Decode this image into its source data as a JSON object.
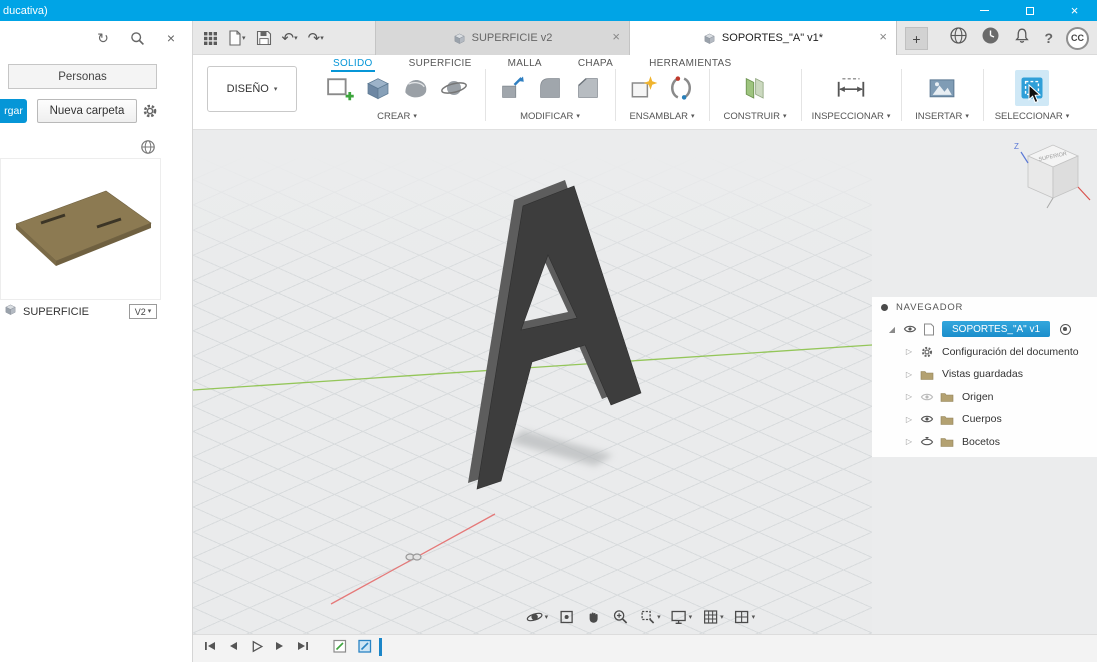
{
  "colors": {
    "accent": "#0696d7",
    "titlebar_blue": "#00a4e6",
    "selection_blue": "#1b8ecb"
  },
  "titlebar": {
    "title": "ducativa)"
  },
  "left_panel": {
    "personas": "Personas",
    "upload": "rgar",
    "new_folder": "Nueva carpeta",
    "item_name": "SUPERFICIE",
    "item_version": "V2"
  },
  "document_tabs": {
    "tab1": "SUPERFICIE v2",
    "tab2": "SOPORTES_\"A\" v1*"
  },
  "account": {
    "initials": "CC"
  },
  "ribbon": {
    "workspace": "DISEÑO",
    "tabs": [
      {
        "label": "SOLIDO",
        "active": true
      },
      {
        "label": "SUPERFICIE",
        "active": false
      },
      {
        "label": "MALLA",
        "active": false
      },
      {
        "label": "CHAPA",
        "active": false
      },
      {
        "label": "HERRAMIENTAS",
        "active": false
      }
    ],
    "groups": [
      {
        "label": "CREAR"
      },
      {
        "label": "MODIFICAR"
      },
      {
        "label": "ENSAMBLAR"
      },
      {
        "label": "CONSTRUIR"
      },
      {
        "label": "INSPECCIONAR"
      },
      {
        "label": "INSERTAR"
      },
      {
        "label": "SELECCIONAR"
      }
    ]
  },
  "navegador": {
    "title": "NAVEGADOR",
    "root_label": "SOPORTES_\"A\" v1",
    "rows": [
      {
        "label": "Configuración del documento"
      },
      {
        "label": "Vistas guardadas"
      },
      {
        "label": "Origen"
      },
      {
        "label": "Cuerpos"
      },
      {
        "label": "Bocetos"
      }
    ]
  },
  "viewcube": {
    "z_label": "Z",
    "top_label": "SUPERIOR"
  }
}
